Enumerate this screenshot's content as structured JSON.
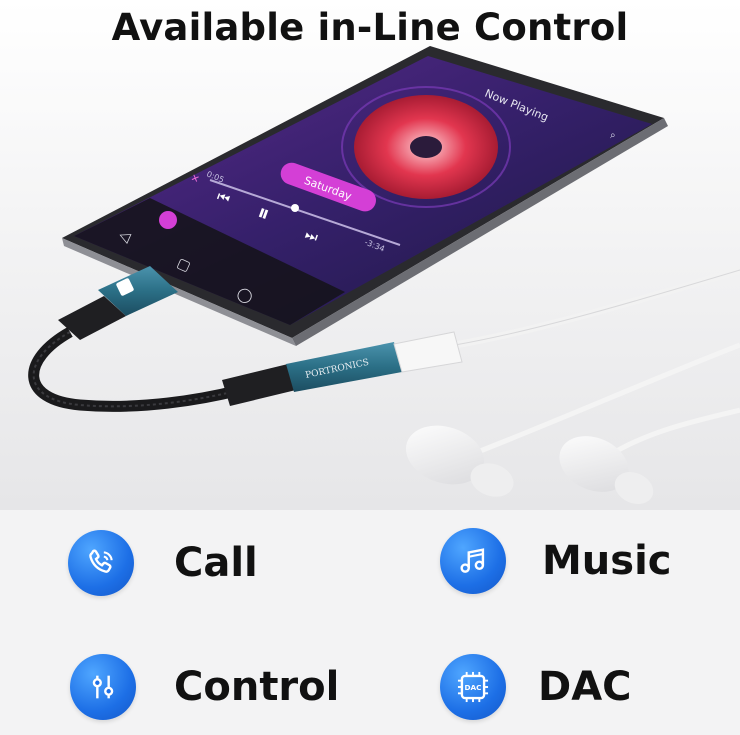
{
  "headline": "Available in-Line Control",
  "phone": {
    "now_playing": "Now Playing",
    "song": "Saturday",
    "time_elapsed": "0:05",
    "time_remaining": "-3:34",
    "brand": "PORTRONICS"
  },
  "features": [
    {
      "label": "Call",
      "icon": "phone-icon"
    },
    {
      "label": "Music",
      "icon": "music-note-icon"
    },
    {
      "label": "Control",
      "icon": "sliders-icon"
    },
    {
      "label": "DAC",
      "icon": "chip-icon",
      "badge": "DAC"
    }
  ],
  "colors": {
    "accent_blue": "#1d6fe6",
    "screen_purple": "#3a1f6e",
    "song_pill": "#d43fd6",
    "adapter_blue": "#2b6f86"
  }
}
